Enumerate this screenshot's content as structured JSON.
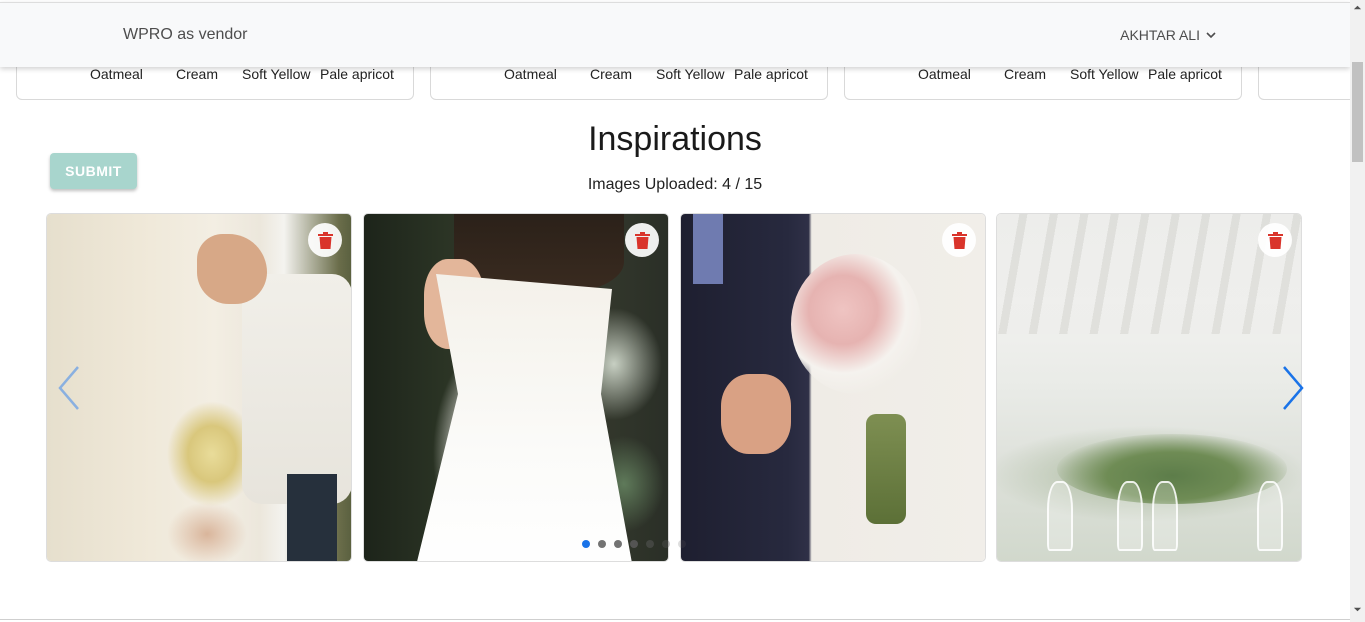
{
  "header": {
    "brand": "WPRO as vendor",
    "user_name": "AKHTAR ALI"
  },
  "palettes": [
    {
      "colors": [
        "Oatmeal",
        "Cream",
        "Soft Yellow",
        "Pale apricot"
      ]
    },
    {
      "colors": [
        "Oatmeal",
        "Cream",
        "Soft Yellow",
        "Pale apricot"
      ]
    },
    {
      "colors": [
        "Oatmeal",
        "Cream",
        "Soft Yellow",
        "Pale apricot"
      ]
    }
  ],
  "main": {
    "title": "Inspirations",
    "counter_label": "Images Uploaded:",
    "counter_value": "4 / 15",
    "submit_label": "SUBMIT"
  },
  "carousel": {
    "slides": [
      "bride-bouquet-photo",
      "bride-white-dress-photo",
      "groom-bride-photo",
      "wedding-table-photo"
    ],
    "dot_count": 7,
    "active_dot": 0
  },
  "colors": {
    "accent": "#1a73e8",
    "submit_bg": "#a8d5cd",
    "delete": "#d9342b",
    "header_bg": "#f8f9fa"
  }
}
